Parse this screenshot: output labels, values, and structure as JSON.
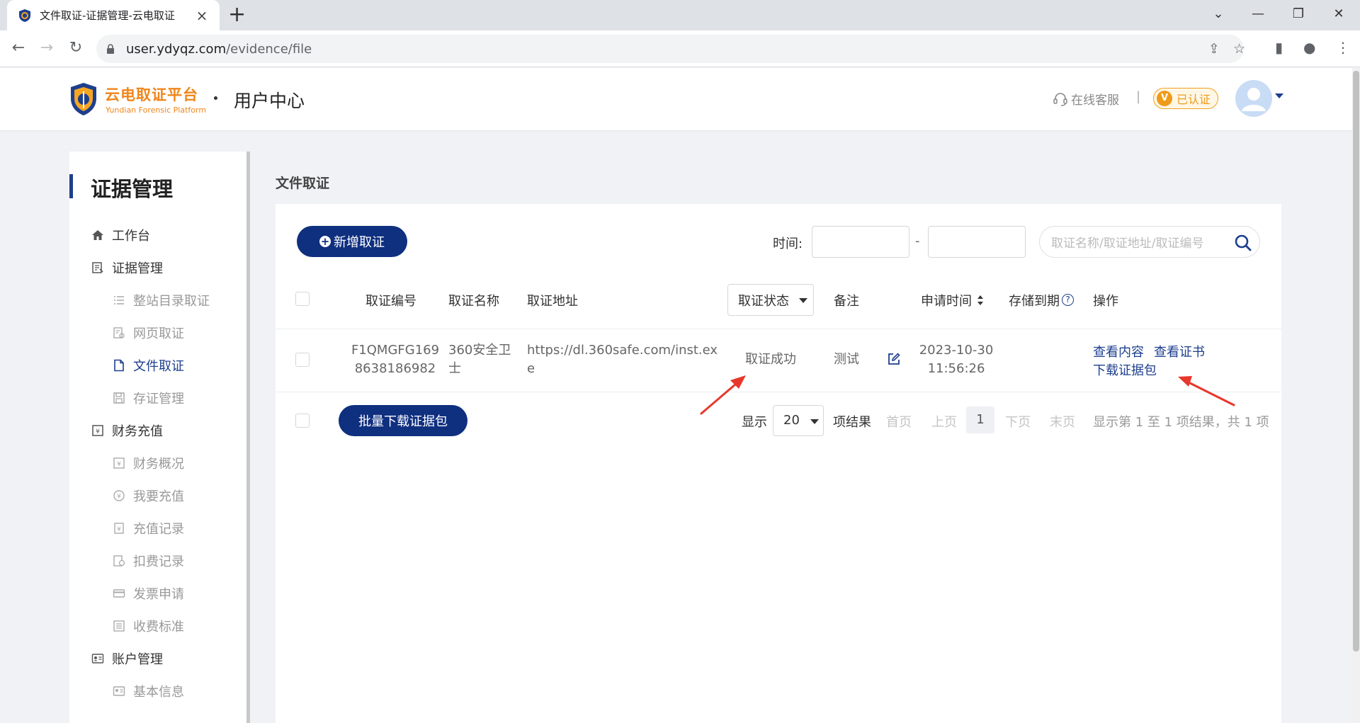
{
  "browser": {
    "tab_title": "文件取证-证据管理-云电取证",
    "new_tab": "+",
    "url_host": "user.ydyqz.com",
    "url_path": "/evidence/file"
  },
  "header": {
    "brand_cn": "云电取证平台",
    "brand_en": "Yundian Forensic Platform",
    "user_center": "用户中心",
    "service": "在线客服",
    "separator": "|",
    "verified": "已认证",
    "verified_badge": "V"
  },
  "sidebar": {
    "title": "证据管理",
    "groups": [
      {
        "label": "工作台",
        "icon": "home-icon"
      },
      {
        "label": "证据管理",
        "icon": "evidence-icon",
        "children": [
          {
            "label": "整站目录取证",
            "icon": "list-icon"
          },
          {
            "label": "网页取证",
            "icon": "webpage-icon"
          },
          {
            "label": "文件取证",
            "icon": "file-icon",
            "active": true
          },
          {
            "label": "存证管理",
            "icon": "save-icon"
          }
        ]
      },
      {
        "label": "财务充值",
        "icon": "finance-icon",
        "children": [
          {
            "label": "财务概况",
            "icon": "overview-icon"
          },
          {
            "label": "我要充值",
            "icon": "recharge-icon"
          },
          {
            "label": "充值记录",
            "icon": "record-icon"
          },
          {
            "label": "扣费记录",
            "icon": "deduct-icon"
          },
          {
            "label": "发票申请",
            "icon": "invoice-icon"
          },
          {
            "label": "收费标准",
            "icon": "pricing-icon"
          }
        ]
      },
      {
        "label": "账户管理",
        "icon": "account-icon",
        "children": [
          {
            "label": "基本信息",
            "icon": "profile-icon"
          }
        ]
      }
    ]
  },
  "main": {
    "page_title": "文件取证",
    "new_button": "新增取证",
    "new_button_icon": "+",
    "time_label": "时间:",
    "date_separator": "-",
    "search_placeholder": "取证名称/取证地址/取证编号",
    "columns": {
      "id": "取证编号",
      "name": "取证名称",
      "address": "取证地址",
      "status": "取证状态",
      "note": "备注",
      "apply_time": "申请时间",
      "storage": "存储到期",
      "storage_help": "?",
      "actions": "操作"
    },
    "rows": [
      {
        "id_line1": "F1QMGFG169",
        "id_line2": "8638186982",
        "name_line1": "360安全卫",
        "name_line2": "士",
        "address_line1": "https://dl.360safe.com/inst.ex",
        "address_line2": "e",
        "status": "取证成功",
        "note": "测试",
        "date": "2023-10-30",
        "time": "11:56:26",
        "storage": "",
        "action_view_content": "查看内容",
        "action_view_cert": "查看证书",
        "action_download": "下载证据包"
      }
    ],
    "batch_button": "批量下载证据包",
    "pagination": {
      "show_label": "显示",
      "page_size": "20",
      "items_label": "项结果",
      "first": "首页",
      "prev": "上页",
      "current": "1",
      "next": "下页",
      "last": "末页",
      "info": "显示第 1 至 1 项结果，共 1 项"
    }
  },
  "colors": {
    "primary": "#0f2f7f",
    "brand_orange": "#f08519",
    "annotation_red": "#e8372b"
  }
}
